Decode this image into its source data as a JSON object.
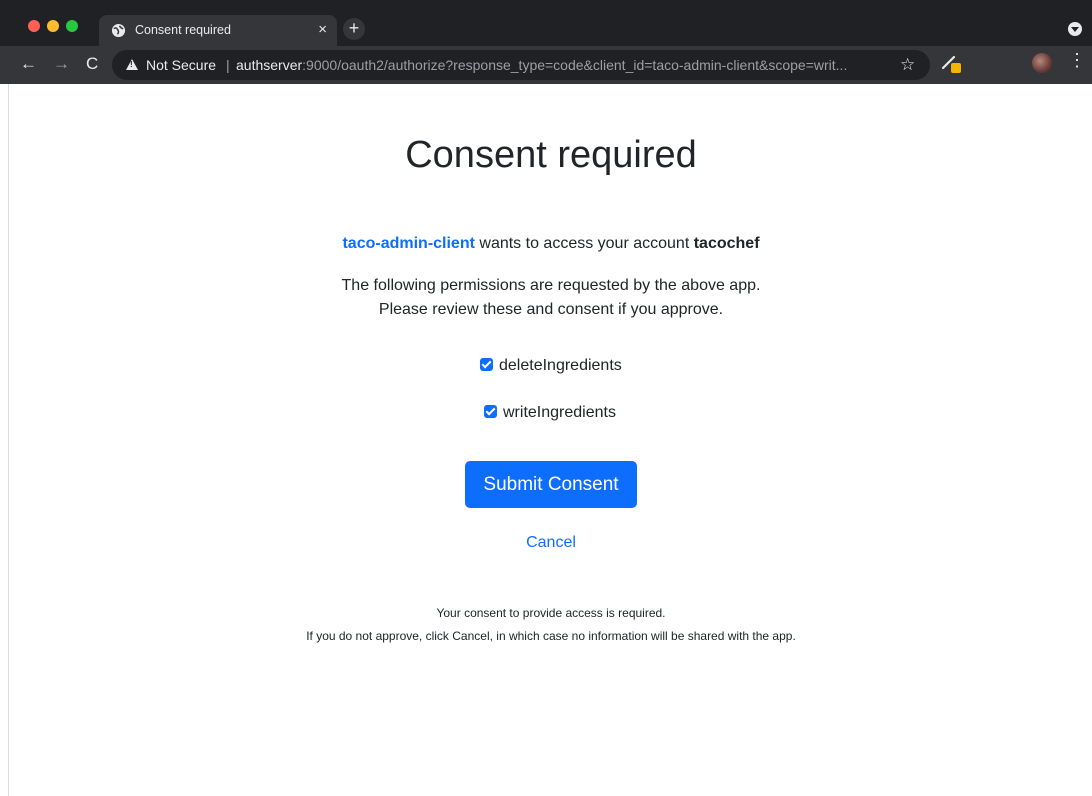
{
  "browser": {
    "tab": {
      "title": "Consent required",
      "close_glyph": "×"
    },
    "new_tab_glyph": "+",
    "toolbar": {
      "back_glyph": "←",
      "forward_glyph": "→",
      "reload_glyph": "C",
      "security_label": "Not Secure",
      "separator": "|",
      "url_host": "authserver",
      "url_rest": ":9000/oauth2/authorize?response_type=code&client_id=taco-admin-client&scope=writ...",
      "star_glyph": "☆",
      "menu_glyph": "⋮",
      "puzzle_glyph": "✱"
    },
    "icons": [
      "globe-icon",
      "warning-icon",
      "star-icon",
      "extension-icon",
      "puzzle-icon",
      "avatar",
      "kebab-menu-icon"
    ]
  },
  "consent": {
    "title": "Consent required",
    "client_id": "taco-admin-client",
    "wants_text": " wants to access your account ",
    "account": "tacochef",
    "description_line1": "The following permissions are requested by the above app.",
    "description_line2": "Please review these and consent if you approve.",
    "permissions": [
      {
        "label": "deleteIngredients",
        "checked": true
      },
      {
        "label": "writeIngredients",
        "checked": true
      }
    ],
    "submit_label": "Submit Consent",
    "cancel_label": "Cancel",
    "footnote_line1": "Your consent to provide access is required.",
    "footnote_line2": "If you do not approve, click Cancel, in which case no information will be shared with the app."
  },
  "colors": {
    "accent": "#0d6efd",
    "chrome_dark": "#202124",
    "chrome_tab": "#35363a"
  }
}
